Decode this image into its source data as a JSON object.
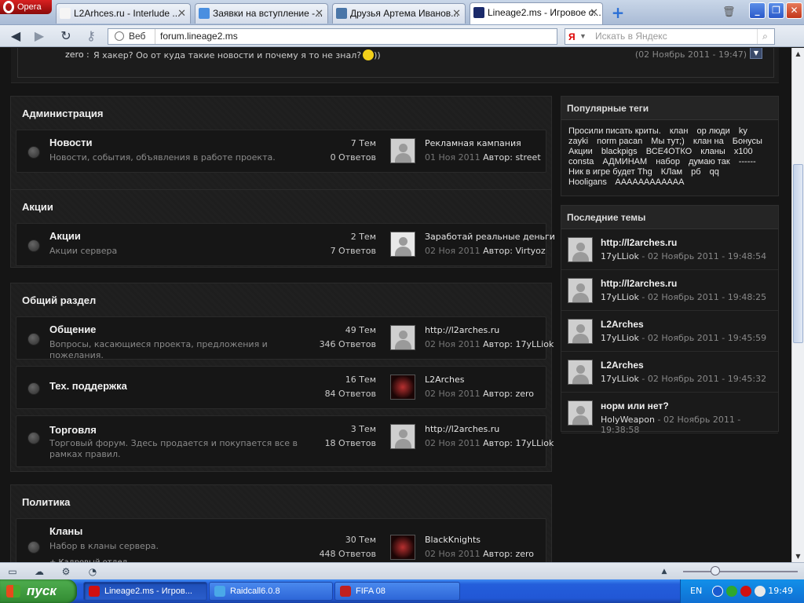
{
  "browser": {
    "menu_label": "Opera",
    "tabs": [
      {
        "title": "L2Arhces.ru - Interlude ...",
        "color": "#f5f5f5"
      },
      {
        "title": "Заявки на вступление -...",
        "color": "#4a8fe0"
      },
      {
        "title": "Друзья Артема Иванов...",
        "color": "#4a76a8"
      },
      {
        "title": "Lineage2.ms - Игровое с...",
        "color": "#1a2a6a",
        "active": true
      }
    ],
    "address": {
      "prefix": "Веб",
      "url": "forum.lineage2.ms"
    },
    "search": {
      "engine": "Я",
      "placeholder": "Искать в Яндекс"
    }
  },
  "shoutbox": {
    "name": "zero :",
    "message": "Я хакер? Оо от куда такие новости и почему я то не знал?",
    "after_smile": "))",
    "time": "(02 Ноябрь 2011 - 19:47)"
  },
  "categories": [
    {
      "title": "Администрация",
      "forums": [
        {
          "title": "Новости",
          "desc": "Новости, события, объявления в работе проекта.",
          "topics": "7 Тем",
          "replies": "0 Ответов",
          "last_title": "Рекламная кампания",
          "last_date": "01 Ноя 2011",
          "author_label": "Автор:",
          "author": "street",
          "avatar": "default"
        }
      ]
    },
    {
      "title": "Акции",
      "forums": [
        {
          "title": "Акции",
          "desc": "Акции сервера",
          "topics": "2 Тем",
          "replies": "7 Ответов",
          "last_title": "Заработай реальные деньги",
          "last_date": "02 Ноя 2011",
          "author_label": "Автор:",
          "author": "Virtyoz",
          "avatar": "sketch"
        }
      ]
    },
    {
      "title": "Общий раздел",
      "forums": [
        {
          "title": "Общение",
          "desc": "Вопросы, касающиеся проекта, предложения и пожелания.",
          "topics": "49 Тем",
          "replies": "346 Ответов",
          "last_title": "http://l2arches.ru",
          "last_date": "02 Ноя 2011",
          "author_label": "Автор:",
          "author": "17yLLiok",
          "avatar": "default"
        },
        {
          "title": "Тех. поддержка",
          "desc": "",
          "topics": "16 Тем",
          "replies": "84 Ответов",
          "last_title": "L2Arches",
          "last_date": "02 Ноя 2011",
          "author_label": "Автор:",
          "author": "zero",
          "avatar": "warrior"
        },
        {
          "title": "Торговля",
          "desc": "Торговый форум. Здесь продается и покупается все в рамках правил.",
          "topics": "3 Тем",
          "replies": "18 Ответов",
          "last_title": "http://l2arches.ru",
          "last_date": "02 Ноя 2011",
          "author_label": "Автор:",
          "author": "17yLLiok",
          "avatar": "default"
        }
      ]
    },
    {
      "title": "Политика",
      "forums": [
        {
          "title": "Кланы",
          "desc": "Набор в кланы сервера.",
          "topics": "30 Тем",
          "replies": "448 Ответов",
          "last_title": "BlackKnights",
          "last_date": "02 Ноя 2011",
          "author_label": "Автор:",
          "author": "zero",
          "avatar": "warrior",
          "subforum": "+ Кадровый отдел"
        }
      ]
    }
  ],
  "sidebar": {
    "tags_title": "Популярные теги",
    "tags": [
      "Просили писать криты.",
      "клан",
      "ор люди",
      "ky zayki",
      "norm pacan",
      "Мы тут;)",
      "клан на",
      "Бонусы Акции",
      "blackpigs",
      "ВСЕ4ОТКО",
      "кланы",
      "х100",
      "consta",
      "АДМИНАМ",
      "набор",
      "думаю так",
      "------",
      "Ник в игре будет Thg",
      "КЛам",
      "рб",
      "qq",
      "Hooligans",
      "AAAAAAAAAAAA"
    ],
    "recent_title": "Последние темы",
    "recent": [
      {
        "title": "http://l2arches.ru",
        "author": "17yLLiok",
        "date": " - 02 Ноябрь 2011 - 19:48:54"
      },
      {
        "title": "http://l2arches.ru",
        "author": "17yLLiok",
        "date": " - 02 Ноябрь 2011 - 19:48:25"
      },
      {
        "title": "L2Arches",
        "author": "17yLLiok",
        "date": " - 02 Ноябрь 2011 - 19:45:59"
      },
      {
        "title": "L2Arches",
        "author": "17yLLiok",
        "date": " - 02 Ноябрь 2011 - 19:45:32"
      },
      {
        "title": "норм или нет?",
        "author": "HolyWeapon",
        "date": " - 02 Ноябрь 2011 - 19:38:58"
      }
    ]
  },
  "taskbar": {
    "start_label": "пуск",
    "tasks": [
      {
        "label": "Lineage2.ms - Игров...",
        "color": "#d01010",
        "active": true
      },
      {
        "label": "Raidcall6.0.8",
        "color": "#4aa8e8",
        "active": false
      },
      {
        "label": "FIFA 08",
        "color": "#c02020",
        "active": false
      }
    ],
    "lang": "EN",
    "clock": "19:49"
  }
}
